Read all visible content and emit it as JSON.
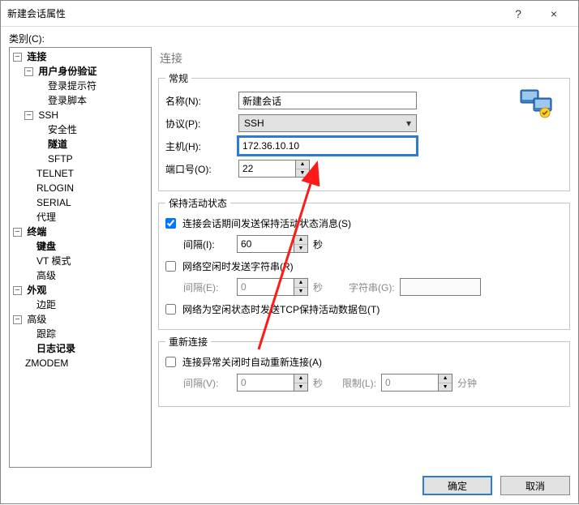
{
  "window": {
    "title": "新建会话属性",
    "help": "?",
    "close": "×"
  },
  "category_label": "类别(C):",
  "tree": {
    "connection": "连接",
    "userauth": "用户身份验证",
    "loginprompt": "登录提示符",
    "loginscript": "登录脚本",
    "ssh": "SSH",
    "security": "安全性",
    "tunnel": "隧道",
    "sftp": "SFTP",
    "telnet": "TELNET",
    "rlogin": "RLOGIN",
    "serial": "SERIAL",
    "proxy": "代理",
    "terminal": "终端",
    "keyboard": "键盘",
    "vtmode": "VT 模式",
    "t_advanced": "高级",
    "appearance": "外观",
    "margin": "边距",
    "advanced": "高级",
    "trace": "跟踪",
    "logging": "日志记录",
    "zmodem": "ZMODEM"
  },
  "heading": "连接",
  "general": {
    "legend": "常规",
    "name_label": "名称(N):",
    "name_value": "新建会话",
    "protocol_label": "协议(P):",
    "protocol_value": "SSH",
    "host_label": "主机(H):",
    "host_value": "172.36.10.10",
    "port_label": "端口号(O):",
    "port_value": "22"
  },
  "keepalive": {
    "legend": "保持活动状态",
    "send_status_label": "连接会话期间发送保持活动状态消息(S)",
    "send_status_checked": true,
    "interval_i_label": "间隔(I):",
    "interval_i_value": "60",
    "seconds": "秒",
    "send_idle_str_label": "网络空闲时发送字符串(R)",
    "send_idle_str_checked": false,
    "interval_e_label": "间隔(E):",
    "interval_e_value": "0",
    "string_g_label": "字符串(G):",
    "string_g_value": "",
    "send_tcp_label": "网络为空闲状态时发送TCP保持活动数据包(T)",
    "send_tcp_checked": false
  },
  "reconnect": {
    "legend": "重新连接",
    "auto_reconnect_label": "连接异常关闭时自动重新连接(A)",
    "auto_reconnect_checked": false,
    "interval_v_label": "间隔(V):",
    "interval_v_value": "0",
    "limit_l_label": "限制(L):",
    "limit_l_value": "0",
    "minutes": "分钟"
  },
  "buttons": {
    "ok": "确定",
    "cancel": "取消"
  }
}
